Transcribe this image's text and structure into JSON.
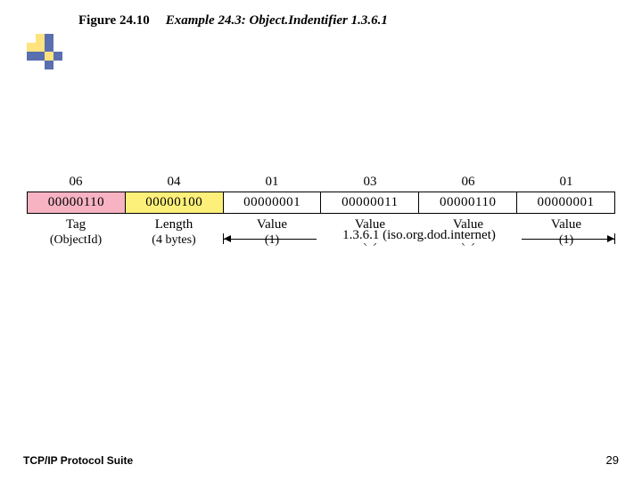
{
  "header": {
    "figure_label": "Figure 24.10",
    "figure_title": "Example 24.3: Object.Indentifier 1.3.6.1"
  },
  "cells": [
    {
      "hex": "06",
      "bin": "00000110",
      "label": "Tag",
      "sub": "(ObjectId)",
      "fill": "pink"
    },
    {
      "hex": "04",
      "bin": "00000100",
      "label": "Length",
      "sub": "(4 bytes)",
      "fill": "yellow"
    },
    {
      "hex": "01",
      "bin": "00000001",
      "label": "Value",
      "sub": "(1)",
      "fill": ""
    },
    {
      "hex": "03",
      "bin": "00000011",
      "label": "Value",
      "sub": "(3)",
      "fill": ""
    },
    {
      "hex": "06",
      "bin": "00000110",
      "label": "Value",
      "sub": "(6)",
      "fill": ""
    },
    {
      "hex": "01",
      "bin": "00000001",
      "label": "Value",
      "sub": "(1)",
      "fill": ""
    }
  ],
  "dimension_label": "1.3.6.1  (iso.org.dod.internet)",
  "footer": {
    "left": "TCP/IP Protocol Suite",
    "page": "29"
  }
}
